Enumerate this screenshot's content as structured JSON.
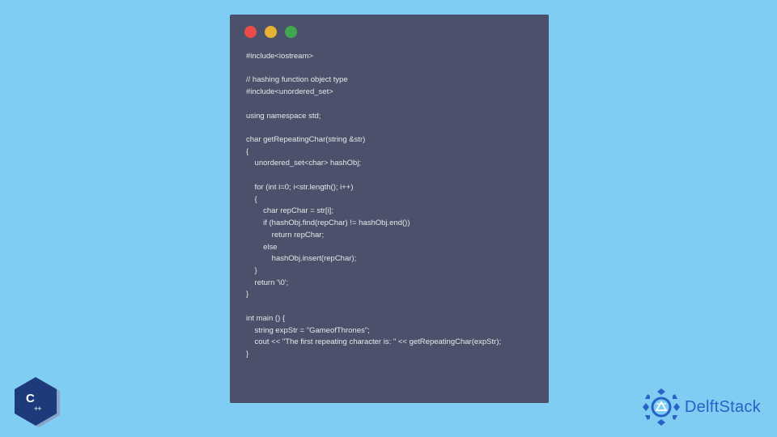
{
  "colors": {
    "bg": "#7fcdf2",
    "window": "#4b516b",
    "dot_red": "#e94b4b",
    "dot_yellow": "#e8b334",
    "dot_green": "#3fa84e",
    "code_text": "#e8e8e8",
    "cpp_badge": "#1d3b7a",
    "delft_blue": "#2961c7"
  },
  "code": "#include<iostream>\n\n// hashing function object type\n#include<unordered_set>\n\nusing namespace std;\n\nchar getRepeatingChar(string &str)\n{\n    unordered_set<char> hashObj;\n\n    for (int i=0; i<str.length(); i++)\n    {\n        char repChar = str[i];\n        if (hashObj.find(repChar) != hashObj.end())\n            return repChar;\n        else\n            hashObj.insert(repChar);\n    }\n    return '\\0';\n}\n\nint main () {\n    string expStr = \"GameofThrones\";\n    cout << \"The first repeating character is: \" << getRepeatingChar(expStr);\n}",
  "cpp_badge": {
    "main": "C",
    "plus": "++"
  },
  "brand": {
    "name": "DelftStack"
  }
}
